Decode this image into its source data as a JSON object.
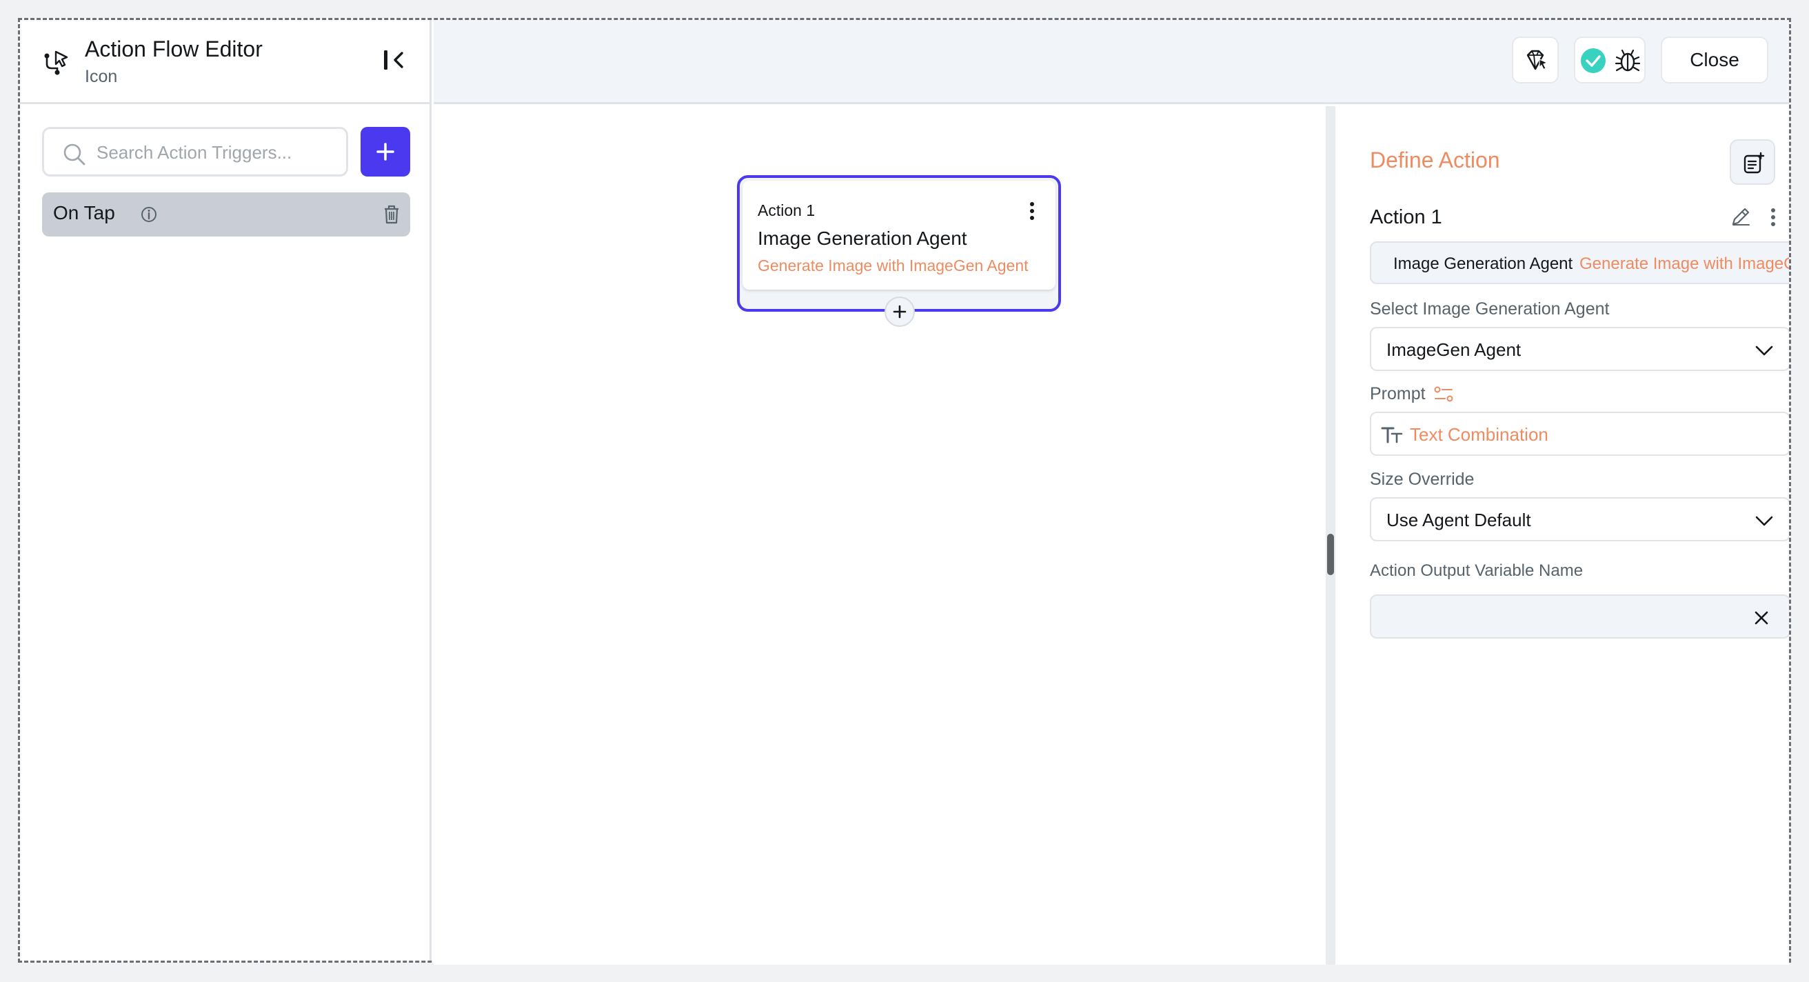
{
  "header": {
    "title": "Action Flow Editor",
    "subtitle": "Icon"
  },
  "search": {
    "placeholder": "Search Action Triggers..."
  },
  "triggers": [
    {
      "label": "On Tap"
    }
  ],
  "toolbar": {
    "close_label": "Close"
  },
  "node": {
    "kicker": "Action 1",
    "title": "Image Generation Agent",
    "subtitle": "Generate Image with ImageGen Agent"
  },
  "define": {
    "title": "Define Action",
    "action_name": "Action 1",
    "summary_type": "Image Generation Agent",
    "summary_desc": "Generate Image with ImageGen Agent",
    "agent_label": "Select Image Generation Agent",
    "agent_value": "ImageGen Agent",
    "prompt_label": "Prompt",
    "prompt_value": "Text Combination",
    "size_label": "Size Override",
    "size_value": "Use Agent Default",
    "output_label": "Action Output Variable Name",
    "output_value": ""
  },
  "colors": {
    "primary": "#4b39ef",
    "accent": "#ee8b60",
    "success": "#39d2c0"
  },
  "icons": {
    "flow": "flow-branch-icon",
    "collapse": "collapse-sidebar-icon",
    "search": "search-icon",
    "add": "plus-icon",
    "info": "info-icon",
    "delete": "trash-icon",
    "gem": "gem-cursor-icon",
    "check": "check-circle-icon",
    "bug": "bug-icon",
    "menu": "more-vertical-icon",
    "edit": "pencil-icon",
    "notes": "notes-add-icon",
    "chevron": "chevron-down-icon",
    "text": "text-type-icon",
    "variables": "variables-icon",
    "clear": "close-icon"
  }
}
